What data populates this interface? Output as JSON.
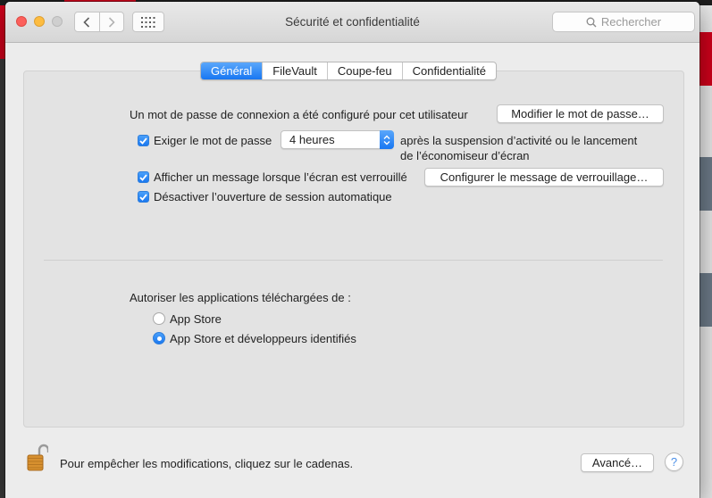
{
  "window": {
    "title": "Sécurité et confidentialité"
  },
  "search": {
    "placeholder": "Rechercher"
  },
  "tabs": [
    {
      "label": "Général",
      "active": true
    },
    {
      "label": "FileVault",
      "active": false
    },
    {
      "label": "Coupe-feu",
      "active": false
    },
    {
      "label": "Confidentialité",
      "active": false
    }
  ],
  "general": {
    "password_text": "Un mot de passe de connexion a été configuré pour cet utilisateur",
    "change_password_button": "Modifier le mot de passe…",
    "require_password": {
      "checked": true,
      "label": "Exiger le mot de passe",
      "selected": "4 heures",
      "after_line1": "après la suspension d’activité ou le lancement",
      "after_line2": "de l’économiseur d’écran"
    },
    "show_message": {
      "checked": true,
      "label": "Afficher un message lorsque l’écran est verrouillé",
      "button": "Configurer le message de verrouillage…"
    },
    "disable_autologin": {
      "checked": true,
      "label": "Désactiver l’ouverture de session automatique"
    },
    "downloads": {
      "heading": "Autoriser les applications téléchargées de :",
      "options": [
        {
          "label": "App Store",
          "selected": false
        },
        {
          "label": "App Store et développeurs identifiés",
          "selected": true
        }
      ]
    }
  },
  "footer": {
    "lock_text": "Pour empêcher les modifications, cliquez sur le cadenas.",
    "advanced_button": "Avancé…",
    "help": "?"
  },
  "colors": {
    "accent": "#1b78f0",
    "close": "#fc605c",
    "minimize": "#fdbc40"
  }
}
